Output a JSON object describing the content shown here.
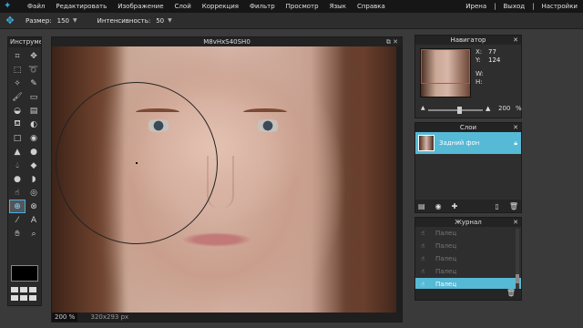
{
  "menubar": {
    "items": [
      "Файл",
      "Редактировать",
      "Изображение",
      "Слой",
      "Коррекция",
      "Фильтр",
      "Просмотр",
      "Язык",
      "Справка"
    ],
    "user": "Ирена",
    "logout": "Выход",
    "settings": "Настройки"
  },
  "options": {
    "size_label": "Размер:",
    "size_value": "150",
    "intensity_label": "Интенсивность:",
    "intensity_value": "50"
  },
  "toolbox": {
    "title": "Инструменты",
    "tools": [
      "crop-icon",
      "move-icon",
      "marquee-icon",
      "lasso-icon",
      "wand-icon",
      "pencil-icon",
      "brush-icon",
      "eraser-icon",
      "bucket-icon",
      "gradient-icon",
      "stamp-icon",
      "replace-color-icon",
      "drawing-icon",
      "red-eye-icon",
      "sharpen-icon",
      "blur-icon",
      "drop-icon",
      "sponge-icon",
      "dodge-icon",
      "burn-icon",
      "finger-icon",
      "liquify-icon",
      "bloat-icon",
      "pinch-icon",
      "color-picker-icon",
      "type-icon",
      "hand-icon",
      "zoom-icon"
    ],
    "active_index": 22
  },
  "document": {
    "title": "M8vHxS40SH0",
    "zoom": "200 %",
    "dims": "320x293 px"
  },
  "navigator": {
    "title": "Навигатор",
    "x_label": "X:",
    "x": "77",
    "y_label": "Y:",
    "y": "124",
    "w_label": "W:",
    "h_label": "H:",
    "zoom": "200",
    "zoom_unit": "%"
  },
  "layers": {
    "title": "Слои",
    "items": [
      {
        "name": "Задний фон"
      }
    ]
  },
  "history": {
    "title": "Журнал",
    "items": [
      "Палец",
      "Палец",
      "Палец",
      "Палец",
      "Палец"
    ],
    "selected": "Палец"
  },
  "colors": {
    "accent": "#56b9d6",
    "menubar": "#161616",
    "panel": "#2e2e2e"
  }
}
